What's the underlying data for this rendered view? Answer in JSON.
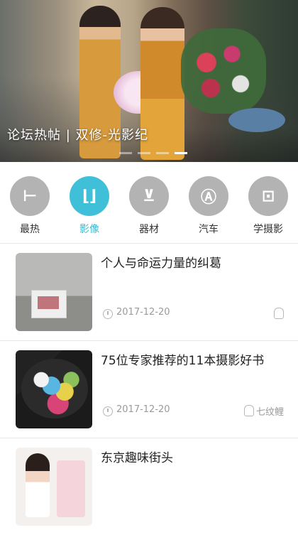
{
  "banner": {
    "caption": "论坛热帖 | 双修-光影纪",
    "dots": 4,
    "active_dot": 3
  },
  "categories": [
    {
      "label": "最热",
      "icon": "hot-icon",
      "glyph": "H",
      "active": false
    },
    {
      "label": "影像",
      "icon": "image-icon",
      "glyph": "L.J",
      "active": true
    },
    {
      "label": "器材",
      "icon": "equipment-icon",
      "glyph": "切",
      "active": false
    },
    {
      "label": "汽车",
      "icon": "car-icon",
      "glyph": "A",
      "active": false
    },
    {
      "label": "学摄影",
      "icon": "learn-photography-icon",
      "glyph": "E",
      "active": false
    }
  ],
  "articles": [
    {
      "title": "个人与命运力量的纠葛",
      "date": "2017-12-20",
      "author": "",
      "thumb": "thumb-room"
    },
    {
      "title": "75位专家推荐的11本摄影好书",
      "date": "2017-12-20",
      "author": "七纹鲤",
      "thumb": "thumb-parrot"
    },
    {
      "title": "东京趣味街头",
      "date": "",
      "author": "",
      "thumb": "thumb-people"
    }
  ],
  "colors": {
    "accent": "#3fc0d8",
    "icon_gray": "#b3b3b3"
  }
}
